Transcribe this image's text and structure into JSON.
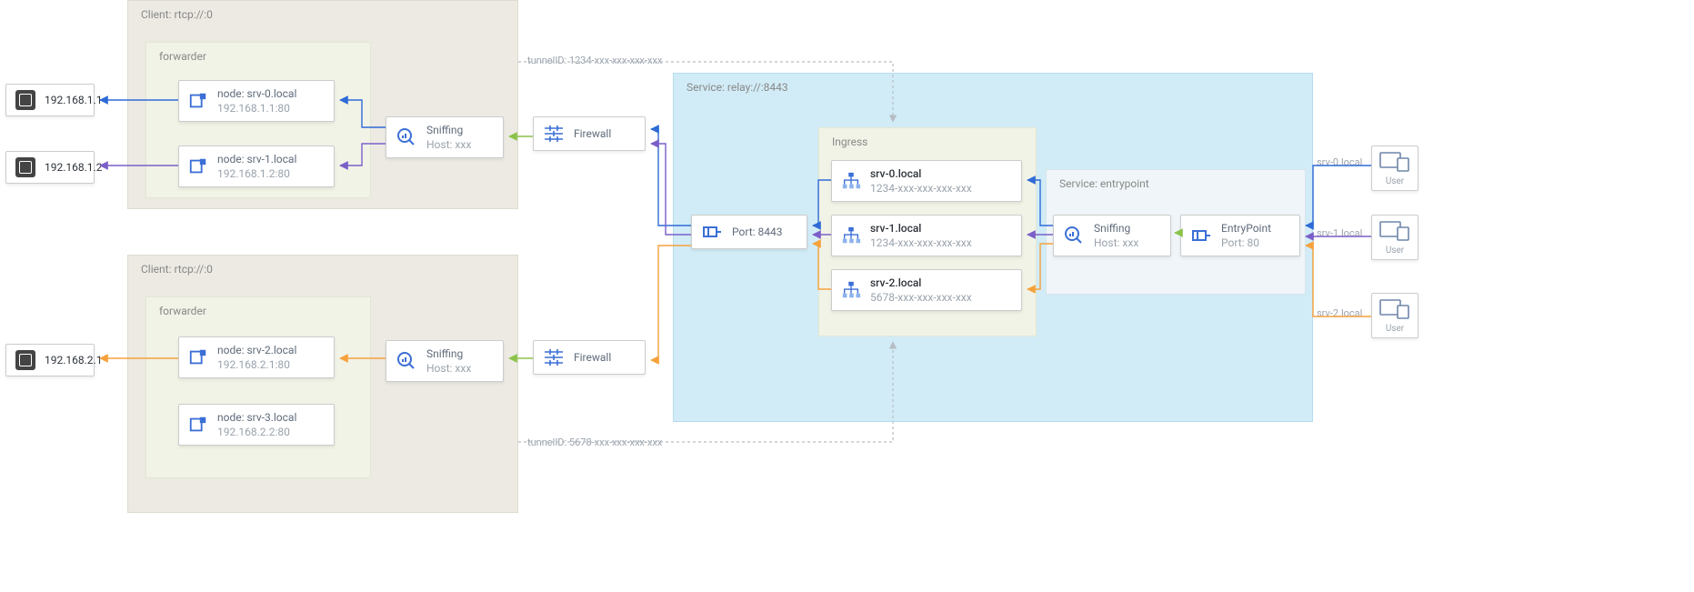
{
  "client1": {
    "title": "Client: rtcp://:0"
  },
  "client2": {
    "title": "Client: rtcp://:0"
  },
  "forwarder": {
    "title": "forwarder"
  },
  "service": {
    "title": "Service: relay://:8443"
  },
  "ingress": {
    "title": "Ingress"
  },
  "entrypointBox": {
    "title": "Service: entrypoint"
  },
  "cpu": {
    "a": "192.168.1.1",
    "b": "192.168.1.2",
    "c": "192.168.2.1"
  },
  "fwd1": {
    "n0": {
      "title": "node: srv-0.local",
      "sub": "192.168.1.1:80"
    },
    "n1": {
      "title": "node: srv-1.local",
      "sub": "192.168.1.2:80"
    }
  },
  "fwd2": {
    "n2": {
      "title": "node: srv-2.local",
      "sub": "192.168.2.1:80"
    },
    "n3": {
      "title": "node: srv-3.local",
      "sub": "192.168.2.2:80"
    }
  },
  "sniff": {
    "title": "Sniffing",
    "sub": "Host: xxx"
  },
  "firewall": {
    "title": "Firewall"
  },
  "port": {
    "title": "Port: 8443"
  },
  "ing": {
    "s0": {
      "title": "srv-0.local",
      "sub": "1234-xxx-xxx-xxx-xxx"
    },
    "s1": {
      "title": "srv-1.local",
      "sub": "1234-xxx-xxx-xxx-xxx"
    },
    "s2": {
      "title": "srv-2.local",
      "sub": "5678-xxx-xxx-xxx-xxx"
    }
  },
  "ep": {
    "title": "EntryPoint",
    "sub": "Port: 80"
  },
  "tunnel": {
    "t1": "tunnelID: 1234-xxx-xxx-xxx-xxx",
    "t2": "tunnelID: 5678-xxx-xxx-xxx-xxx"
  },
  "users": {
    "label": "User",
    "h0": "srv-0.local",
    "h1": "srv-1.local",
    "h2": "srv-2.local"
  },
  "colors": {
    "blue": "#2f6bd6",
    "purple": "#7b5fc9",
    "orange": "#f6a23c",
    "green": "#8bc34a",
    "grey": "#b7bdc4"
  }
}
